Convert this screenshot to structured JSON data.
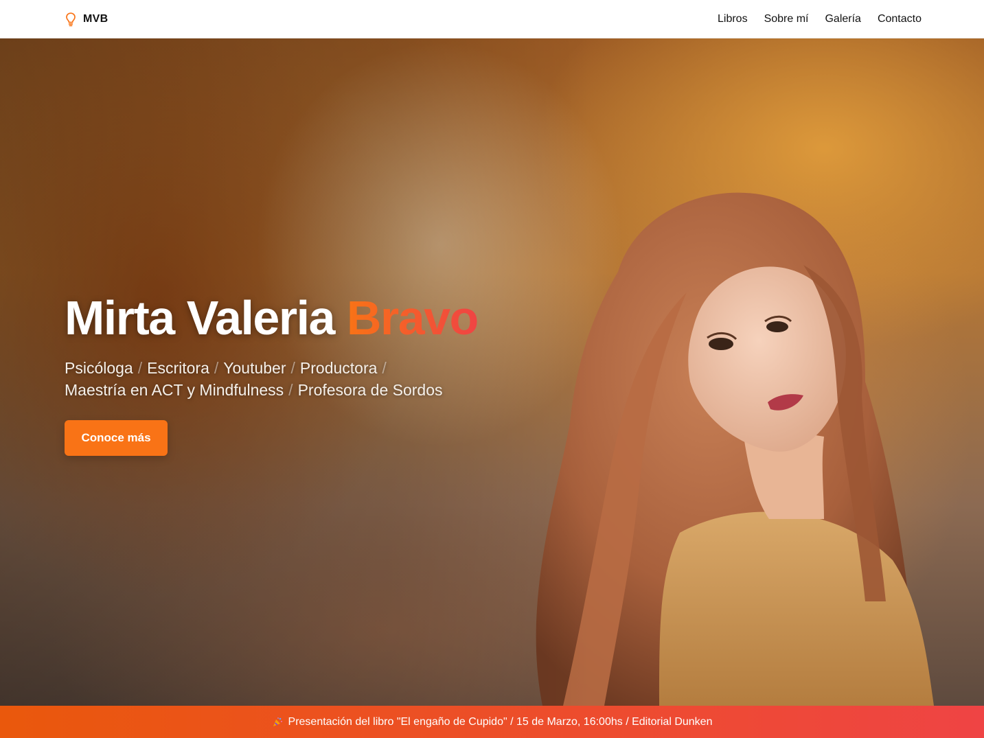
{
  "brand": {
    "name": "MVB",
    "icon": "lightbulb-icon",
    "accent_color": "#f97316"
  },
  "nav": {
    "links": [
      {
        "label": "Libros"
      },
      {
        "label": "Sobre mí"
      },
      {
        "label": "Galería"
      },
      {
        "label": "Contacto"
      }
    ]
  },
  "hero": {
    "first_name": "Mirta Valeria",
    "last_name": "Bravo",
    "roles": [
      "Psicóloga",
      "Escritora",
      "Youtuber",
      "Productora",
      "Maestría en ACT y Mindfulness",
      "Profesora de Sordos"
    ],
    "separator": "/",
    "cta_label": "Conoce más"
  },
  "announcement": {
    "icon": "party-popper-icon",
    "text": "Presentación del libro \"El engaño de Cupido\" / 15 de Marzo, 16:00hs / Editorial Dunken",
    "gradient": [
      "#ea580c",
      "#ef4444"
    ]
  }
}
